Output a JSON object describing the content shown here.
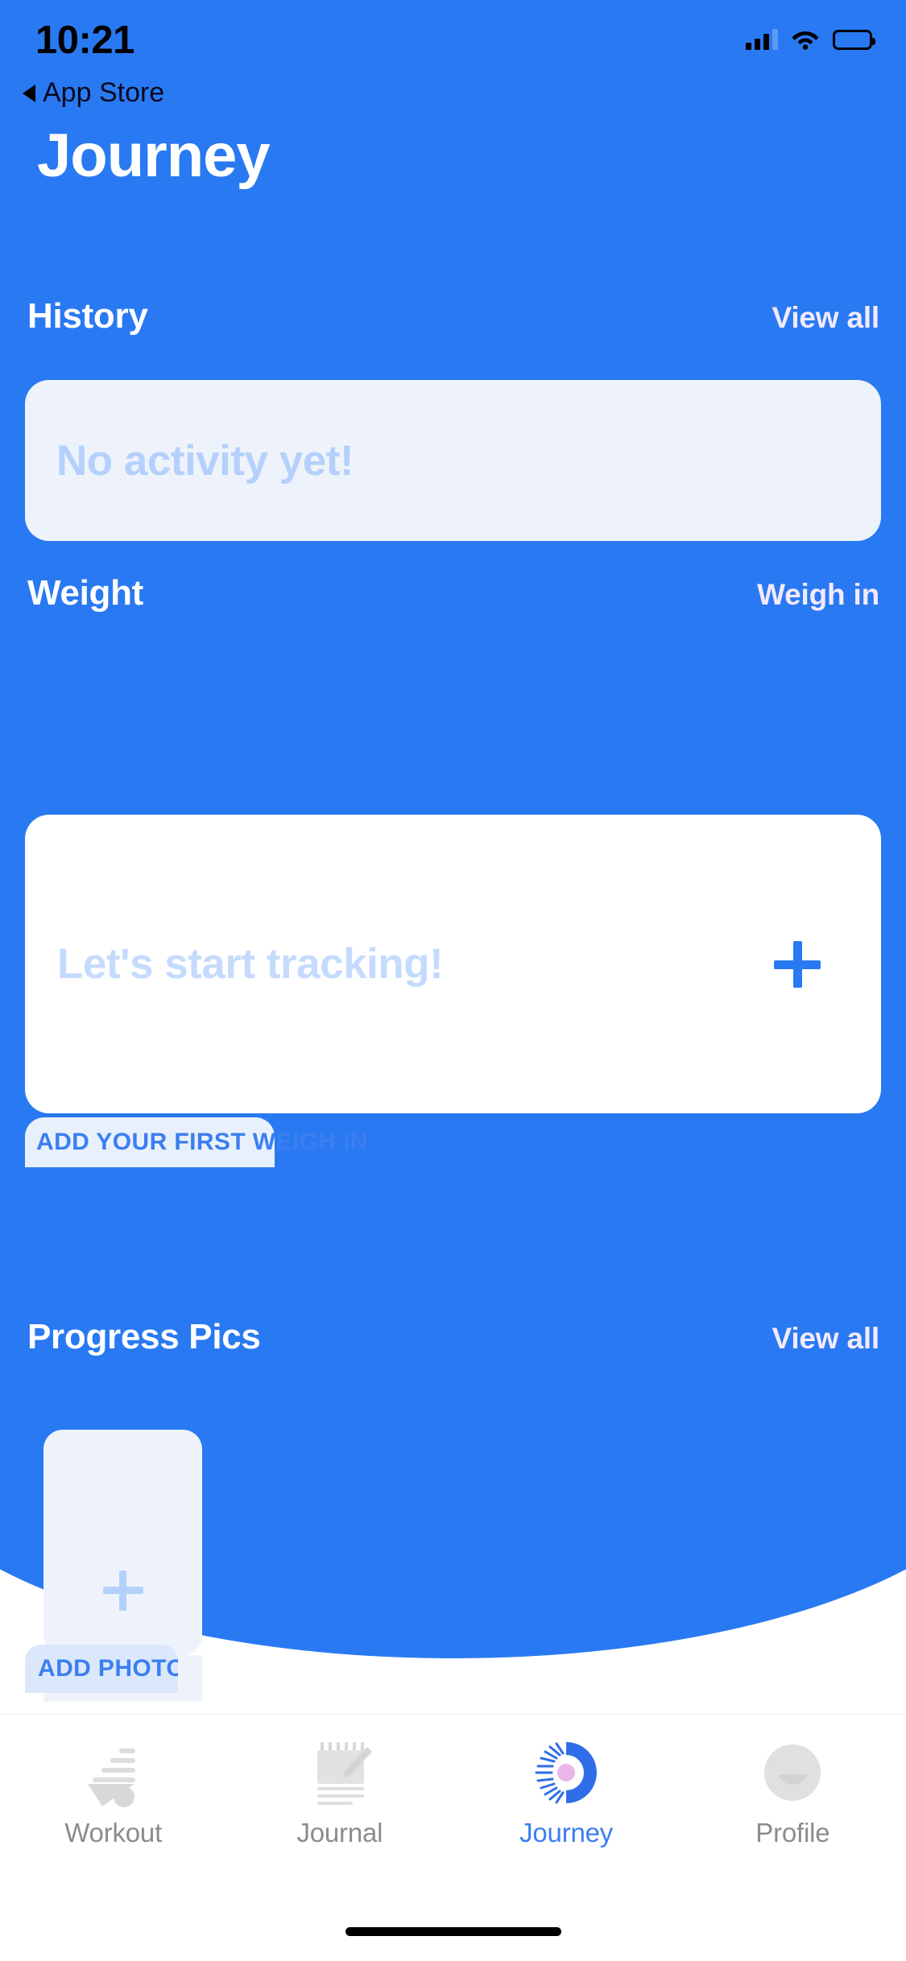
{
  "status_bar": {
    "time": "10:21",
    "signal_icon": "cellular-signal-icon",
    "wifi_icon": "wifi-icon",
    "battery_icon": "battery-icon"
  },
  "back": {
    "label": "App Store",
    "icon": "back-triangle-icon"
  },
  "header": {
    "title": "Journey"
  },
  "sections": {
    "history": {
      "title": "History",
      "action": "View all",
      "empty_text": "No activity yet!"
    },
    "weight": {
      "title": "Weight",
      "action": "Weigh in",
      "empty_text": "Let's start tracking!",
      "add_icon": "plus-icon",
      "badge_text": "ADD YOUR FIRST WEIGH IN"
    },
    "progress_pics": {
      "title": "Progress Pics",
      "action": "View all",
      "add_icon": "plus-icon",
      "badge_text": "ADD PHOTO"
    }
  },
  "tab_bar": {
    "items": [
      {
        "label": "Workout",
        "icon": "workout-icon",
        "active": false
      },
      {
        "label": "Journal",
        "icon": "journal-icon",
        "active": false
      },
      {
        "label": "Journey",
        "icon": "journey-sun-icon",
        "active": true
      },
      {
        "label": "Profile",
        "icon": "profile-avatar-icon",
        "active": false
      }
    ]
  },
  "colors": {
    "brand_blue": "#2979f2",
    "accent_link": "#3b7ef0",
    "card_light": "#eef3fb",
    "card_white": "#ffffff",
    "muted_text": "#8c8c8c",
    "placeholder_blue": "#b4d0fb"
  }
}
